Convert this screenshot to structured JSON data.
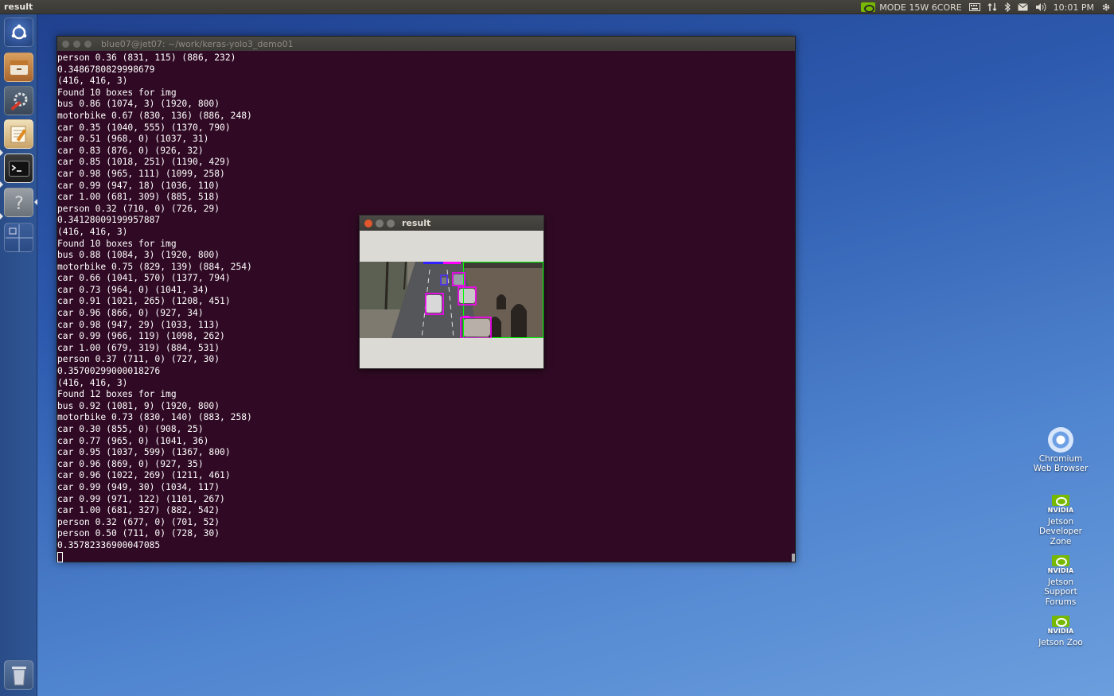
{
  "top_panel": {
    "title": "result",
    "mode": "MODE 15W 6CORE",
    "time": "10:01 PM"
  },
  "launcher": {
    "items": [
      "dash",
      "files",
      "settings",
      "text-editor",
      "terminal",
      "help",
      "workspaces",
      "trash"
    ]
  },
  "terminal": {
    "title": "blue07@jet07: ~/work/keras-yolo3_demo01",
    "lines": [
      "person 0.36 (831, 115) (886, 232)",
      "0.3486780829998679",
      "(416, 416, 3)",
      "Found 10 boxes for img",
      "bus 0.86 (1074, 3) (1920, 800)",
      "motorbike 0.67 (830, 136) (886, 248)",
      "car 0.35 (1040, 555) (1370, 790)",
      "car 0.51 (968, 0) (1037, 31)",
      "car 0.83 (876, 0) (926, 32)",
      "car 0.85 (1018, 251) (1190, 429)",
      "car 0.98 (965, 111) (1099, 258)",
      "car 0.99 (947, 18) (1036, 110)",
      "car 1.00 (681, 309) (885, 518)",
      "person 0.32 (710, 0) (726, 29)",
      "0.34128009199957887",
      "(416, 416, 3)",
      "Found 10 boxes for img",
      "bus 0.88 (1084, 3) (1920, 800)",
      "motorbike 0.75 (829, 139) (884, 254)",
      "car 0.66 (1041, 570) (1377, 794)",
      "car 0.73 (964, 0) (1041, 34)",
      "car 0.91 (1021, 265) (1208, 451)",
      "car 0.96 (866, 0) (927, 34)",
      "car 0.98 (947, 29) (1033, 113)",
      "car 0.99 (966, 119) (1098, 262)",
      "car 1.00 (679, 319) (884, 531)",
      "person 0.37 (711, 0) (727, 30)",
      "0.35700299000018276",
      "(416, 416, 3)",
      "Found 12 boxes for img",
      "bus 0.92 (1081, 9) (1920, 800)",
      "motorbike 0.73 (830, 140) (883, 258)",
      "car 0.30 (855, 0) (908, 25)",
      "car 0.77 (965, 0) (1041, 36)",
      "car 0.95 (1037, 599) (1367, 800)",
      "car 0.96 (869, 0) (927, 35)",
      "car 0.96 (1022, 269) (1211, 461)",
      "car 0.99 (949, 30) (1034, 117)",
      "car 0.99 (971, 122) (1101, 267)",
      "car 1.00 (681, 327) (882, 542)",
      "person 0.32 (677, 0) (701, 52)",
      "person 0.50 (711, 0) (728, 30)",
      "0.35782336900047085"
    ]
  },
  "result_window": {
    "title": "result"
  },
  "desktop_icons": [
    {
      "label": "Chromium Web Browser",
      "icon": "chromium-icon"
    },
    {
      "label": "Jetson Developer Zone",
      "icon": "nvidia-icon"
    },
    {
      "label": "Jetson Support Forums",
      "icon": "nvidia-icon"
    },
    {
      "label": "Jetson Zoo",
      "icon": "nvidia-icon"
    }
  ],
  "nvidia_word": "NVIDIA",
  "colors": {
    "terminal_bg": "#300a24",
    "nvidia_green": "#76b900",
    "box_magenta": "#ff00ff",
    "box_green": "#00ff00",
    "box_blue": "#3020ff",
    "close_orange": "#e2572d"
  }
}
